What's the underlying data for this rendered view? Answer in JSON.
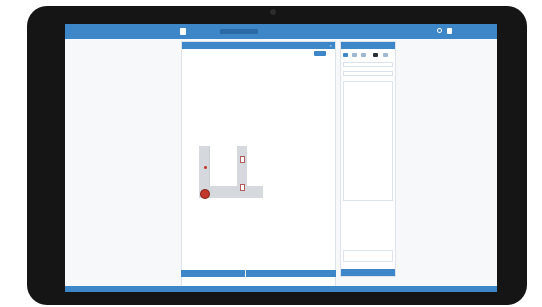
{
  "colors": {
    "accent": "#3d87c8",
    "marker": "#c0392b",
    "bezel": "#151515"
  },
  "topbar": {
    "logo_sub": "",
    "app_title": "",
    "account": ""
  },
  "canvas": {
    "header": "",
    "sub_left": "",
    "sub_mid": "",
    "sub_btn": ""
  },
  "settings_card": {
    "title": "",
    "sections": [
      "",
      "",
      "",
      ""
    ],
    "rows": [
      {
        "field": "",
        "value": "",
        "btn": ""
      },
      {
        "field": "",
        "value": "",
        "btn": ""
      },
      {
        "field": "",
        "value": "",
        "btn": ""
      },
      {
        "field": "",
        "value": "",
        "btn": ""
      }
    ],
    "footer": ""
  },
  "canvas_bottom": {
    "zoom": "",
    "left": "",
    "mid": "",
    "right": ""
  },
  "right_panel": {
    "header": "",
    "search_placeholder": "",
    "select_value": "",
    "list": [
      "",
      "",
      "",
      "",
      "",
      "",
      "",
      "",
      "",
      ""
    ],
    "bottom_info": "",
    "footer": ""
  },
  "footer": {
    "items": [
      "",
      "",
      "",
      "",
      ""
    ]
  }
}
